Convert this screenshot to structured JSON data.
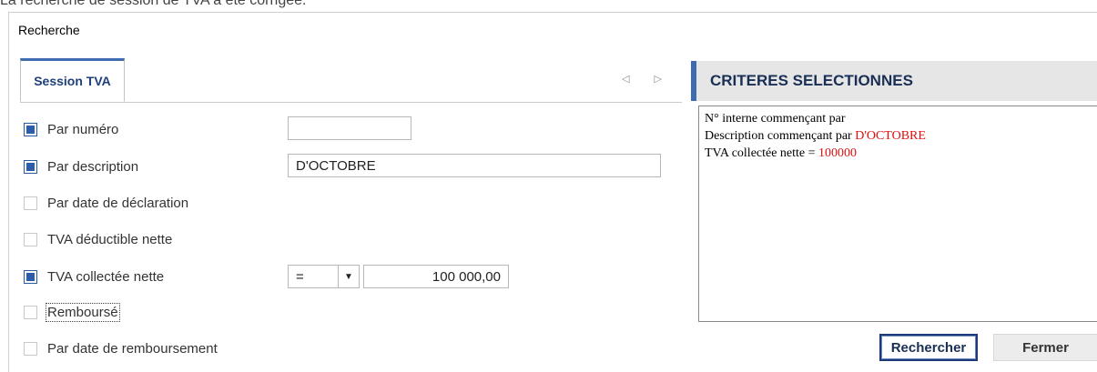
{
  "caption": "La recherche de session de TVA a été corrigée.",
  "window": {
    "title": "Recherche"
  },
  "tab": {
    "label": "Session TVA",
    "nav_icons": "◁ ▷"
  },
  "criteria": [
    {
      "label": "Par numéro",
      "checked": true
    },
    {
      "label": "Par description",
      "checked": true
    },
    {
      "label": "Par date de déclaration",
      "checked": false
    },
    {
      "label": "TVA déductible nette",
      "checked": false
    },
    {
      "label": "TVA collectée nette",
      "checked": true
    },
    {
      "label": "Remboursé",
      "checked": false
    },
    {
      "label": "Par date de remboursement",
      "checked": false
    }
  ],
  "fields": {
    "numero": "",
    "description": "D'OCTOBRE",
    "operator": "=",
    "amount": "100 000,00"
  },
  "selected_panel": {
    "title": "CRITERES SELECTIONNES",
    "lines": [
      {
        "text": "N° interne commençant par",
        "value": ""
      },
      {
        "text": "Description commençant par ",
        "value": "D'OCTOBRE"
      },
      {
        "text": "TVA collectée nette = ",
        "value": " 100000"
      }
    ]
  },
  "buttons": {
    "search": "Rechercher",
    "close": "Fermer"
  },
  "colors": {
    "accent": "#3f6cb0",
    "highlight": "#e01010"
  }
}
